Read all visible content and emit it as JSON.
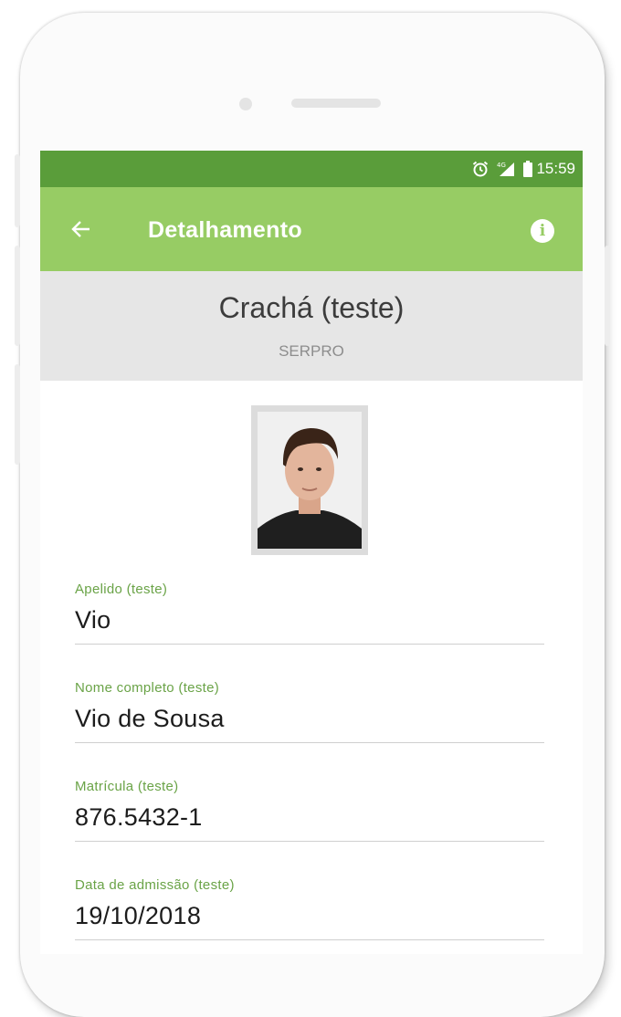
{
  "status_bar": {
    "time": "15:59",
    "icons": [
      "alarm-clock-icon",
      "signal-4g-icon",
      "battery-icon"
    ]
  },
  "app_bar": {
    "title": "Detalhamento",
    "back_icon": "arrow-back-icon",
    "info_icon": "info-icon"
  },
  "header": {
    "title": "Crachá (teste)",
    "subtitle": "SERPRO"
  },
  "fields": [
    {
      "label": "Apelido (teste)",
      "value": "Vio"
    },
    {
      "label": "Nome completo (teste)",
      "value": "Vio de Sousa"
    },
    {
      "label": "Matrícula (teste)",
      "value": "876.5432-1"
    },
    {
      "label": "Data de admissão (teste)",
      "value": "19/10/2018"
    }
  ],
  "colors": {
    "status_bar": "#5a9d3a",
    "app_bar": "#97cc64",
    "label_green": "#6aa347",
    "header_bg": "#e6e6e6"
  }
}
